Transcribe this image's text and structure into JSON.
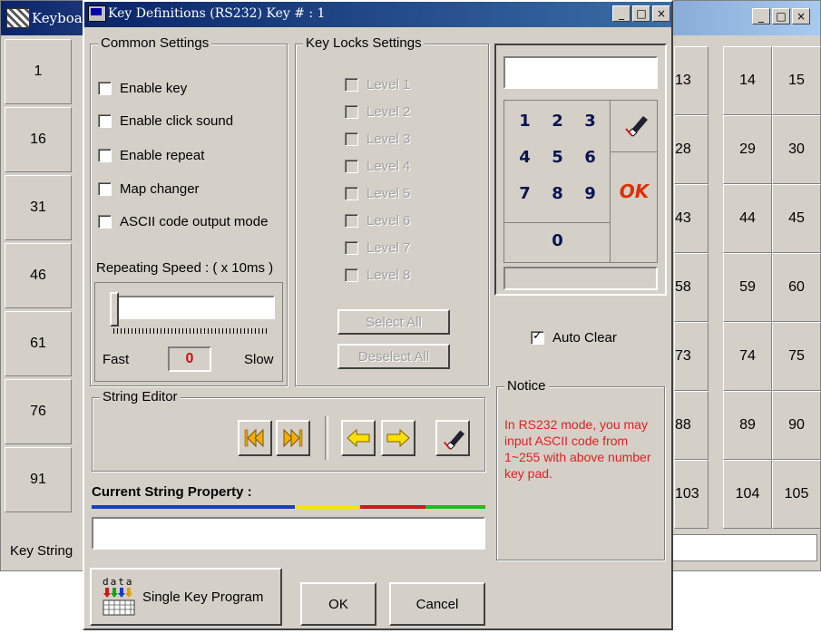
{
  "keyboard_window": {
    "title": "Keyboa",
    "minimize": "_",
    "maximize": "□",
    "close": "×",
    "left_keys": [
      "1",
      "16",
      "31",
      "46",
      "61",
      "76",
      "91"
    ],
    "right_rows": [
      [
        "13",
        "14",
        "15"
      ],
      [
        "28",
        "29",
        "30"
      ],
      [
        "43",
        "44",
        "45"
      ],
      [
        "58",
        "59",
        "60"
      ],
      [
        "73",
        "74",
        "75"
      ],
      [
        "88",
        "89",
        "90"
      ],
      [
        "103",
        "104",
        "105"
      ]
    ],
    "key_string_label": "Key String"
  },
  "dialog": {
    "title": "Key Definitions (RS232) Key # : 1",
    "minimize": "_",
    "maximize": "□",
    "close": "×",
    "common_settings": {
      "legend": "Common Settings",
      "options": [
        "Enable key",
        "Enable click sound",
        "Enable repeat",
        "Map changer",
        "ASCII code output mode"
      ],
      "repeating_speed_label": "Repeating Speed : ( x 10ms )",
      "fast_label": "Fast",
      "slow_label": "Slow",
      "speed_value": "0"
    },
    "key_locks": {
      "legend": "Key Locks Settings",
      "levels": [
        "Level 1",
        "Level 2",
        "Level 3",
        "Level 4",
        "Level 5",
        "Level 6",
        "Level 7",
        "Level 8"
      ],
      "select_all": "Select All",
      "deselect_all": "Deselect All"
    },
    "keypad": {
      "display_value": "",
      "digits": [
        "1",
        "2",
        "3",
        "4",
        "5",
        "6",
        "7",
        "8",
        "9",
        "0"
      ],
      "ok": "OK",
      "status_value": ""
    },
    "auto_clear_label": "Auto Clear",
    "notice": {
      "legend": "Notice",
      "text": "In RS232 mode, you may input ASCII code from 1~255 with above number key pad."
    },
    "string_editor": {
      "legend": "String Editor",
      "icons": [
        "first-icon",
        "last-icon",
        "left-arrow-icon",
        "right-arrow-icon",
        "eraser-icon"
      ]
    },
    "current_string_label": "Current String Property :",
    "current_string_value": "",
    "color_bar": [
      "#1a3cc8",
      "#f4e400",
      "#d01818",
      "#18c018"
    ],
    "single_key_program": {
      "icon_text": "data",
      "label": "Single Key Program"
    },
    "ok_button": "OK",
    "cancel_button": "Cancel"
  }
}
